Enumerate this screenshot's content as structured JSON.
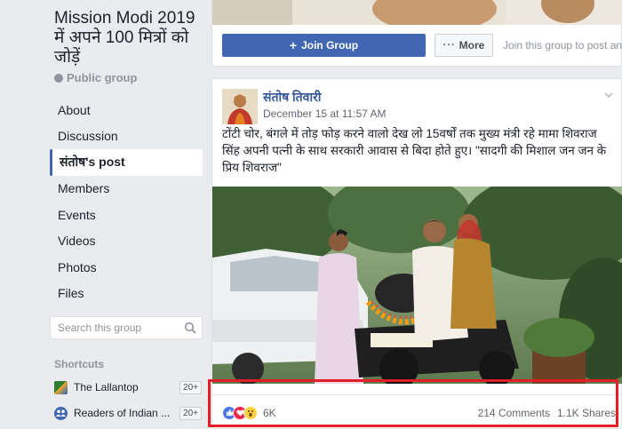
{
  "sidebar": {
    "group_title": "Mission Modi 2019 में अपने 100 मित्रों को जोड़ें",
    "group_type": "Public group",
    "nav": [
      {
        "label": "About"
      },
      {
        "label": "Discussion"
      },
      {
        "label": "संतोष's post"
      },
      {
        "label": "Members"
      },
      {
        "label": "Events"
      },
      {
        "label": "Videos"
      },
      {
        "label": "Photos"
      },
      {
        "label": "Files"
      }
    ],
    "search_placeholder": "Search this group",
    "shortcuts_heading": "Shortcuts",
    "shortcuts": [
      {
        "label": "The Lallantop",
        "badge": "20+"
      },
      {
        "label": "Readers of Indian ...",
        "badge": "20+"
      }
    ]
  },
  "top_card": {
    "join_label": "Join Group",
    "more_label": "More",
    "join_hint": "Join this group to post and"
  },
  "post": {
    "author": "संतोष तिवारी",
    "timestamp": "December 15 at 11:57 AM",
    "text": "टोंटी चोर, बंगले में तोड़ फोड़ करने वालो देख लो 15वर्षों तक मुख्य मंत्री रहे मामा शिवराज सिंह अपनी पत्नी के साथ सरकारी आवास से बिदा होते हुए। \"सादगी की मिशाल जन जन के प्रिय शिवराज\"",
    "reaction_count": "6K",
    "comments": "214 Comments",
    "shares": "1.1K Shares",
    "reactions": [
      "like-icon",
      "love-icon",
      "wow-icon"
    ]
  },
  "colors": {
    "brand": "#4267b2",
    "link": "#365899",
    "highlight": "#e41e26"
  }
}
